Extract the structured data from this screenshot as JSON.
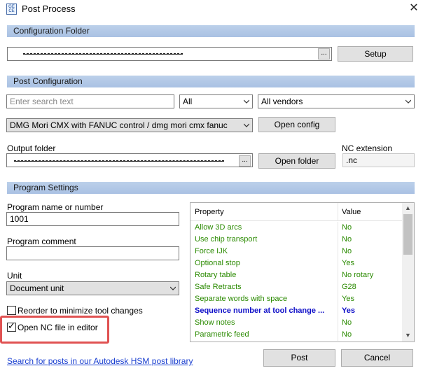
{
  "window": {
    "title": "Post Process",
    "icon_text": "GE\nCE"
  },
  "config_folder": {
    "header": "Configuration Folder",
    "browse_label": "...",
    "setup_label": "Setup"
  },
  "post_config": {
    "header": "Post Configuration",
    "search_placeholder": "Enter search text",
    "filter_value": "All",
    "vendor_value": "All vendors",
    "post_value": "DMG Mori CMX with FANUC control / dmg mori cmx fanuc",
    "open_config_label": "Open config",
    "output_folder_label": "Output folder",
    "browse_label": "...",
    "open_folder_label": "Open folder",
    "nc_extension_label": "NC extension",
    "nc_extension_value": ".nc"
  },
  "program_settings": {
    "header": "Program Settings",
    "program_name_label": "Program name or number",
    "program_name_value": "1001",
    "program_comment_label": "Program comment",
    "program_comment_value": "",
    "unit_label": "Unit",
    "unit_value": "Document unit",
    "reorder_label": "Reorder to minimize tool changes",
    "reorder_checked": false,
    "open_nc_label": "Open NC file in editor",
    "open_nc_checked": true
  },
  "property_grid": {
    "col_property": "Property",
    "col_value": "Value",
    "rows": [
      {
        "property": "Allow 3D arcs",
        "value": "No"
      },
      {
        "property": "Use chip transport",
        "value": "No"
      },
      {
        "property": "Force IJK",
        "value": "No"
      },
      {
        "property": "Optional stop",
        "value": "Yes"
      },
      {
        "property": "Rotary table",
        "value": "No rotary"
      },
      {
        "property": "Safe Retracts",
        "value": "G28"
      },
      {
        "property": "Separate words with space",
        "value": "Yes"
      },
      {
        "property": "Sequence number at tool change ...",
        "value": "Yes"
      },
      {
        "property": "Show notes",
        "value": "No"
      },
      {
        "property": "Parametric feed",
        "value": "No"
      }
    ]
  },
  "footer": {
    "library_link": "Search for posts in our Autodesk HSM post library",
    "post_label": "Post",
    "cancel_label": "Cancel"
  },
  "colors": {
    "section_header": "#a9c1e3",
    "grid_text": "#2a8a00",
    "highlight": "#e05252",
    "link": "#1a3fd0"
  }
}
